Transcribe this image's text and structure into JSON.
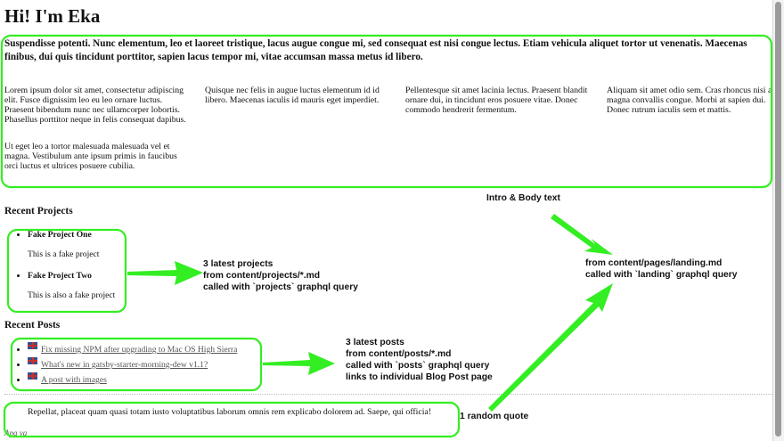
{
  "page": {
    "title": "Hi! I'm Eka",
    "lead": "Suspendisse potenti. Nunc elementum, leo et laoreet tristique, lacus augue congue mi, sed consequat est nisi congue lectus. Etiam vehicula aliquet tortor ut venenatis. Maecenas finibus, dui quis tincidunt porttitor, sapien lacus tempor mi, vitae accumsan massa metus id libero.",
    "columns": [
      {
        "p1": "Lorem ipsum dolor sit amet, consectetur adipiscing elit. Fusce dignissim leo eu leo ornare luctus. Praesent bibendum nunc nec ullamcorper lobortis. Phasellus porttitor neque in felis consequat dapibus.",
        "p2": "Ut eget leo a tortor malesuada malesuada vel et magna. Vestibulum ante ipsum primis in faucibus orci luctus et ultrices posuere cubilia."
      },
      {
        "p1": "Quisque nec felis in augue luctus elementum id id libero. Maecenas iaculis id mauris eget imperdiet."
      },
      {
        "p1": "Pellentesque sit amet lacinia lectus. Praesent blandit ornare dui, in tincidunt eros posuere vitae. Donec commodo hendrerit fermentum."
      },
      {
        "p1": "Aliquam sit amet odio sem. Cras rhoncus nisi ac magna convallis congue. Morbi at sapien dui. Donec rutrum iaculis sem et mattis."
      }
    ]
  },
  "projects": {
    "heading": "Recent Projects",
    "items": [
      {
        "title": "Fake Project One",
        "description": "This is a fake project"
      },
      {
        "title": "Fake Project Two",
        "description": "This is also a fake project"
      }
    ]
  },
  "posts": {
    "heading": "Recent Posts",
    "items": [
      {
        "title": "Fix missing NPM after upgrading to Mac OS High Sierra",
        "flag_icon": "uk-flag-icon"
      },
      {
        "title": "What's new in gatsby-starter-morning-dew v1.1?",
        "flag_icon": "uk-flag-icon"
      },
      {
        "title": "A post with images",
        "flag_icon": "uk-flag-icon"
      }
    ]
  },
  "quote": {
    "text": "Repellat, placeat quam quasi totam iusto voluptatibus laborum omnis rem explicabo dolorem ad. Saepe, qui officia!",
    "author": "Apa ya"
  },
  "annotations": {
    "intro_label": "Intro & Body text",
    "landing": "from content/pages/landing.md\ncalled with `landing` graphql query",
    "projects": "3 latest projects\nfrom content/projects/*.md\ncalled with `projects` graphql query",
    "posts": "3 latest posts\nfrom content/posts/*.md\ncalled with `posts` graphql query\nlinks to individual Blog Post page",
    "quote": "1 random quote"
  },
  "colors": {
    "highlight": "#33ee22",
    "text": "#111111",
    "link": "#555555"
  }
}
